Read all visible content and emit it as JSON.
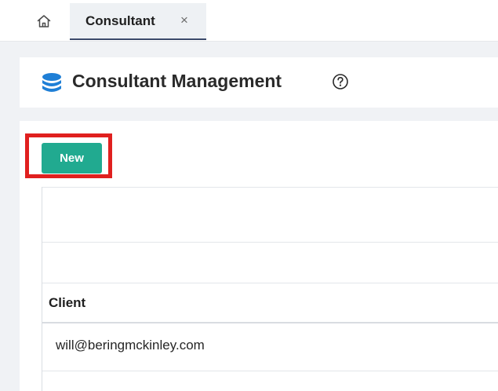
{
  "tabs": {
    "home_icon": "home-icon",
    "active_tab_label": "Consultant",
    "close_symbol": "×"
  },
  "header": {
    "title": "Consultant Management",
    "title_icon": "database-icon",
    "help_icon": "question-circle-icon"
  },
  "toolbar": {
    "new_label": "New"
  },
  "table": {
    "columns": [
      "Client"
    ],
    "rows": [
      [
        "will@beringmckinley.com"
      ]
    ]
  },
  "colors": {
    "accent": "#21aa90",
    "highlight_border": "#e0201f",
    "db_icon": "#1f7fd6",
    "active_tab_underline": "#3b4a6b"
  }
}
